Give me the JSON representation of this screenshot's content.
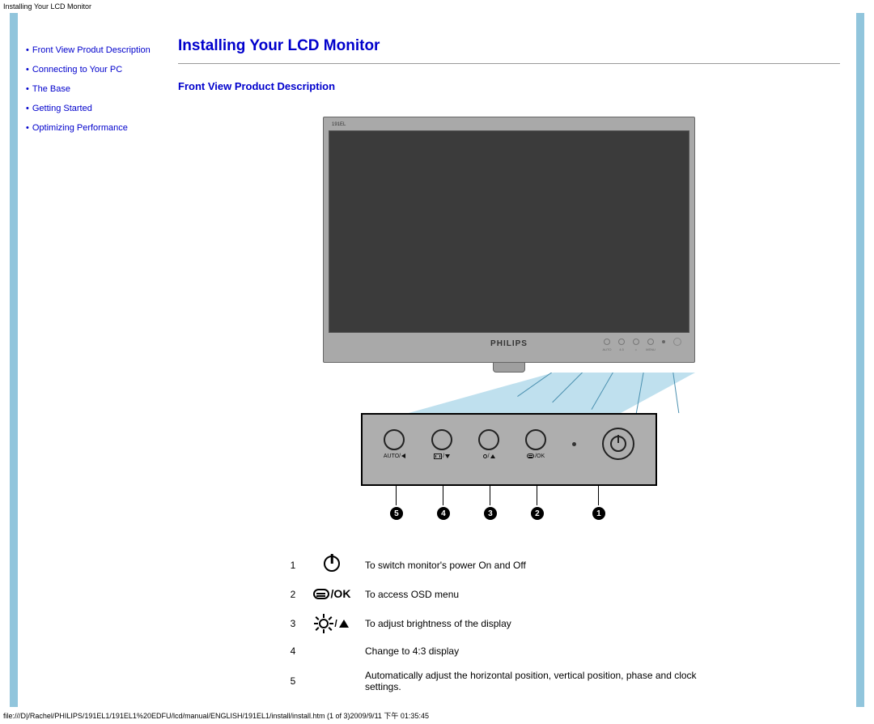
{
  "header": {
    "title": "Installing Your LCD Monitor"
  },
  "sidebar": {
    "items": [
      {
        "label": "Front View Produt Description"
      },
      {
        "label": "Connecting to Your PC"
      },
      {
        "label": "The Base"
      },
      {
        "label": "Getting Started"
      },
      {
        "label": "Optimizing Performance"
      }
    ]
  },
  "main": {
    "title": "Installing Your LCD Monitor",
    "section_title": "Front View Product Description",
    "monitor": {
      "model": "191EL",
      "brand": "PHILIPS",
      "panel_buttons": [
        {
          "label": "AUTO/",
          "callout": "5"
        },
        {
          "label": "/",
          "callout": "4"
        },
        {
          "label": "/",
          "callout": "3"
        },
        {
          "label": "/OK",
          "callout": "2"
        }
      ],
      "power_callout": "1"
    },
    "descriptions": [
      {
        "num": "1",
        "icon": "power",
        "text": "To switch monitor's power On and Off"
      },
      {
        "num": "2",
        "icon": "menu-ok",
        "ok": "/OK",
        "text": "To access OSD menu"
      },
      {
        "num": "3",
        "icon": "brightness-up",
        "slash": "/",
        "text": "To adjust brightness of the display"
      },
      {
        "num": "4",
        "icon": "",
        "text": "Change to 4:3 display"
      },
      {
        "num": "5",
        "icon": "",
        "text": "Automatically adjust the horizontal position, vertical position, phase and clock settings."
      }
    ]
  },
  "footer": {
    "path": "file:///D|/Rachel/PHILIPS/191EL1/191EL1%20EDFU/lcd/manual/ENGLISH/191EL1/install/install.htm (1 of 3)2009/9/11 下午 01:35:45"
  }
}
